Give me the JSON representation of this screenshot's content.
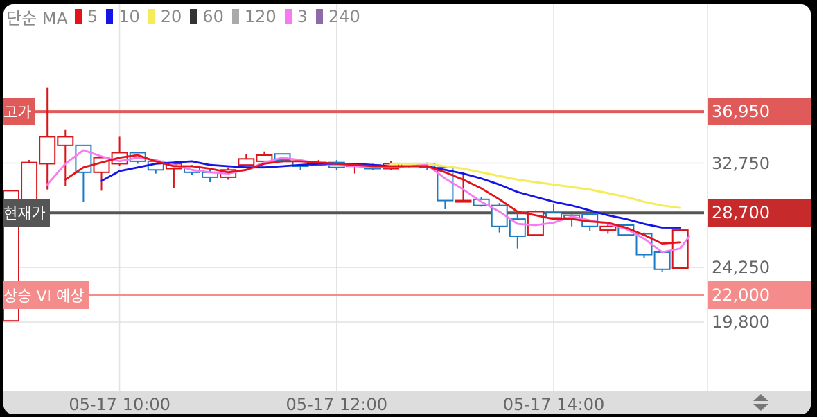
{
  "legend": {
    "label": "단순 MA",
    "items": [
      {
        "period": "5",
        "color": "#e4121a"
      },
      {
        "period": "10",
        "color": "#1414e6"
      },
      {
        "period": "20",
        "color": "#f6ec5a"
      },
      {
        "period": "60",
        "color": "#333333"
      },
      {
        "period": "120",
        "color": "#aaaaaa"
      },
      {
        "period": "3",
        "color": "#f87af0"
      },
      {
        "period": "240",
        "color": "#8e6aa8"
      }
    ]
  },
  "markers": {
    "high": {
      "label": "고가",
      "value": "36,950",
      "price": 36950,
      "color": "#e05a5a"
    },
    "current": {
      "label": "현재가",
      "value": "28,700",
      "price": 28700,
      "color": "#555555",
      "tag_color": "#c62a2a"
    },
    "vi": {
      "label": "상승 VI 예상",
      "value": "22,000",
      "price": 22000,
      "color": "#f58c8c"
    }
  },
  "chart_data": {
    "type": "candlestick",
    "x_ticks": [
      "05-17 10:00",
      "05-17 12:00",
      "05-17 14:00"
    ],
    "y_ticks": [
      "32,750",
      "24,250",
      "19,800"
    ],
    "ylim": [
      15000,
      40400
    ],
    "grid": true,
    "interval_minutes": 10,
    "series": {
      "candles": [
        {
          "time": "09:00",
          "open": 19900,
          "high": 30500,
          "low": 19900,
          "close": 30500
        },
        {
          "time": "09:10",
          "open": 29700,
          "high": 33000,
          "low": 29700,
          "close": 32800
        },
        {
          "time": "09:20",
          "open": 32700,
          "high": 38900,
          "low": 30600,
          "close": 34900
        },
        {
          "time": "09:30",
          "open": 34200,
          "high": 35500,
          "low": 30900,
          "close": 34900
        },
        {
          "time": "09:40",
          "open": 34200,
          "high": 34200,
          "low": 29600,
          "close": 32000
        },
        {
          "time": "09:50",
          "open": 32000,
          "high": 33200,
          "low": 30500,
          "close": 33200
        },
        {
          "time": "10:00",
          "open": 32700,
          "high": 34900,
          "low": 32500,
          "close": 33600
        },
        {
          "time": "10:10",
          "open": 33600,
          "high": 33600,
          "low": 32700,
          "close": 32900
        },
        {
          "time": "10:20",
          "open": 32900,
          "high": 32900,
          "low": 31900,
          "close": 32200
        },
        {
          "time": "10:30",
          "open": 32300,
          "high": 32800,
          "low": 30700,
          "close": 32700
        },
        {
          "time": "10:40",
          "open": 32500,
          "high": 32600,
          "low": 31800,
          "close": 32000
        },
        {
          "time": "10:50",
          "open": 32000,
          "high": 32300,
          "low": 31200,
          "close": 31600
        },
        {
          "time": "11:00",
          "open": 31600,
          "high": 32400,
          "low": 31400,
          "close": 32200
        },
        {
          "time": "11:10",
          "open": 32600,
          "high": 33500,
          "low": 32500,
          "close": 33100
        },
        {
          "time": "11:20",
          "open": 32900,
          "high": 33700,
          "low": 32800,
          "close": 33400
        },
        {
          "time": "11:30",
          "open": 33500,
          "high": 33500,
          "low": 32800,
          "close": 33000
        },
        {
          "time": "11:40",
          "open": 32900,
          "high": 32900,
          "low": 32200,
          "close": 32500
        },
        {
          "time": "11:50",
          "open": 32600,
          "high": 33000,
          "low": 32500,
          "close": 32800
        },
        {
          "time": "12:00",
          "open": 32800,
          "high": 33000,
          "low": 32200,
          "close": 32400
        },
        {
          "time": "12:10",
          "open": 32500,
          "high": 32600,
          "low": 31900,
          "close": 32600
        },
        {
          "time": "12:20",
          "open": 32600,
          "high": 32700,
          "low": 32200,
          "close": 32300
        },
        {
          "time": "12:30",
          "open": 32300,
          "high": 32900,
          "low": 32200,
          "close": 32700
        },
        {
          "time": "12:40",
          "open": 32700,
          "high": 32700,
          "low": 32400,
          "close": 32500
        },
        {
          "time": "12:50",
          "open": 32700,
          "high": 32800,
          "low": 32200,
          "close": 32400
        },
        {
          "time": "13:00",
          "open": 32400,
          "high": 32400,
          "low": 29000,
          "close": 29700
        },
        {
          "time": "13:10",
          "open": 29700,
          "high": 32000,
          "low": 29700,
          "close": 29700
        },
        {
          "time": "13:20",
          "open": 29800,
          "high": 30000,
          "low": 29200,
          "close": 29300
        },
        {
          "time": "13:30",
          "open": 29300,
          "high": 29500,
          "low": 27100,
          "close": 27600
        },
        {
          "time": "13:40",
          "open": 28200,
          "high": 28700,
          "low": 25800,
          "close": 26800
        },
        {
          "time": "13:50",
          "open": 26900,
          "high": 28900,
          "low": 26900,
          "close": 28800
        },
        {
          "time": "14:00",
          "open": 28700,
          "high": 29400,
          "low": 28100,
          "close": 28300
        },
        {
          "time": "14:10",
          "open": 28500,
          "high": 28600,
          "low": 27600,
          "close": 28300
        },
        {
          "time": "14:20",
          "open": 28600,
          "high": 28600,
          "low": 27200,
          "close": 27600
        },
        {
          "time": "14:30",
          "open": 27300,
          "high": 27900,
          "low": 27000,
          "close": 27600
        },
        {
          "time": "14:40",
          "open": 27700,
          "high": 27800,
          "low": 26900,
          "close": 26900
        },
        {
          "time": "14:50",
          "open": 27000,
          "high": 27100,
          "low": 25000,
          "close": 25300
        },
        {
          "time": "15:00",
          "open": 25500,
          "high": 25500,
          "low": 23900,
          "close": 24100
        },
        {
          "time": "15:10",
          "open": 24200,
          "high": 27500,
          "low": 24200,
          "close": 27300
        }
      ],
      "ma5": [
        [
          3,
          31400
        ],
        [
          4,
          32400
        ],
        [
          5,
          32800
        ],
        [
          6,
          33200
        ],
        [
          7,
          33400
        ],
        [
          8,
          32900
        ],
        [
          9,
          32500
        ],
        [
          10,
          32500
        ],
        [
          11,
          32300
        ],
        [
          12,
          32000
        ],
        [
          13,
          32200
        ],
        [
          14,
          32700
        ],
        [
          15,
          32900
        ],
        [
          16,
          32900
        ],
        [
          17,
          32800
        ],
        [
          18,
          32700
        ],
        [
          19,
          32600
        ],
        [
          20,
          32500
        ],
        [
          21,
          32500
        ],
        [
          22,
          32500
        ],
        [
          23,
          32500
        ],
        [
          24,
          32000
        ],
        [
          25,
          31400
        ],
        [
          26,
          30700
        ],
        [
          27,
          29800
        ],
        [
          28,
          28800
        ],
        [
          29,
          28500
        ],
        [
          30,
          28200
        ],
        [
          31,
          28200
        ],
        [
          32,
          28000
        ],
        [
          33,
          27900
        ],
        [
          34,
          27500
        ],
        [
          35,
          26900
        ],
        [
          36,
          26200
        ],
        [
          37,
          26300
        ]
      ],
      "ma10": [
        [
          5,
          31300
        ],
        [
          6,
          32100
        ],
        [
          7,
          32400
        ],
        [
          8,
          32700
        ],
        [
          9,
          32800
        ],
        [
          10,
          32900
        ],
        [
          11,
          32600
        ],
        [
          12,
          32500
        ],
        [
          13,
          32400
        ],
        [
          14,
          32400
        ],
        [
          15,
          32500
        ],
        [
          16,
          32600
        ],
        [
          17,
          32700
        ],
        [
          18,
          32700
        ],
        [
          19,
          32700
        ],
        [
          20,
          32600
        ],
        [
          21,
          32500
        ],
        [
          22,
          32500
        ],
        [
          23,
          32500
        ],
        [
          24,
          32200
        ],
        [
          25,
          31900
        ],
        [
          26,
          31500
        ],
        [
          27,
          31000
        ],
        [
          28,
          30400
        ],
        [
          29,
          30000
        ],
        [
          30,
          29600
        ],
        [
          31,
          29300
        ],
        [
          32,
          28900
        ],
        [
          33,
          28500
        ],
        [
          34,
          28200
        ],
        [
          35,
          27800
        ],
        [
          36,
          27500
        ],
        [
          37,
          27500
        ]
      ],
      "ma20": [
        [
          21,
          32700
        ],
        [
          22,
          32700
        ],
        [
          23,
          32700
        ],
        [
          24,
          32500
        ],
        [
          25,
          32300
        ],
        [
          26,
          32000
        ],
        [
          27,
          31700
        ],
        [
          28,
          31400
        ],
        [
          29,
          31200
        ],
        [
          30,
          31000
        ],
        [
          31,
          30800
        ],
        [
          32,
          30600
        ],
        [
          33,
          30300
        ],
        [
          34,
          30000
        ],
        [
          35,
          29600
        ],
        [
          36,
          29300
        ],
        [
          37,
          29100
        ]
      ],
      "ma3": [
        [
          2,
          31000
        ],
        [
          3,
          32700
        ],
        [
          4,
          33800
        ],
        [
          5,
          33300
        ],
        [
          6,
          32900
        ],
        [
          7,
          33200
        ],
        [
          8,
          33000
        ],
        [
          9,
          32600
        ],
        [
          10,
          32200
        ],
        [
          11,
          32000
        ],
        [
          12,
          31900
        ],
        [
          13,
          32200
        ],
        [
          14,
          32800
        ],
        [
          15,
          33200
        ],
        [
          16,
          33000
        ],
        [
          17,
          32700
        ],
        [
          18,
          32600
        ],
        [
          19,
          32500
        ],
        [
          20,
          32400
        ],
        [
          21,
          32400
        ],
        [
          22,
          32500
        ],
        [
          23,
          32600
        ],
        [
          24,
          31500
        ],
        [
          25,
          30600
        ],
        [
          26,
          29600
        ],
        [
          27,
          28800
        ],
        [
          28,
          27800
        ],
        [
          29,
          27700
        ],
        [
          30,
          27900
        ],
        [
          31,
          28400
        ],
        [
          32,
          28100
        ],
        [
          33,
          27800
        ],
        [
          34,
          27400
        ],
        [
          35,
          26600
        ],
        [
          36,
          25500
        ],
        [
          37,
          25800
        ],
        [
          37.5,
          26800
        ]
      ]
    }
  }
}
